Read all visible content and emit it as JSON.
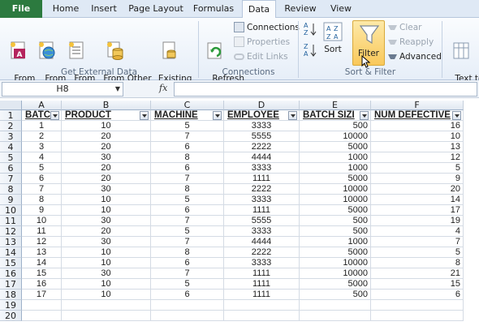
{
  "tabs": [
    "File",
    "Home",
    "Insert",
    "Page Layout",
    "Formulas",
    "Data",
    "Review",
    "View"
  ],
  "active_tab": "Data",
  "ribbon": {
    "from_access": "From\nAccess",
    "from_web": "From\nWeb",
    "from_text": "From\nText",
    "from_other": "From Other\nSources ▾",
    "existing": "Existing\nConnections",
    "group_external": "Get External Data",
    "refresh": "Refresh\nAll ▾",
    "connections": "Connections",
    "properties": "Properties",
    "edit_links": "Edit Links",
    "group_connections": "Connections",
    "sort": "Sort",
    "filter": "Filter",
    "clear": "Clear",
    "reapply": "Reapply",
    "advanced": "Advanced",
    "group_sort": "Sort & Filter",
    "text_to_columns": "Text to\nColumns"
  },
  "formula_bar": {
    "name_box": "H8",
    "fx": "fx",
    "formula": ""
  },
  "columns": [
    "A",
    "B",
    "C",
    "D",
    "E",
    "F"
  ],
  "headers": [
    "BATC",
    "PRODUCT",
    "MACHINE",
    "EMPLOYEE",
    "BATCH SIZI",
    "NUM DEFECTIVE"
  ],
  "row_numbers": [
    "1",
    "2",
    "3",
    "4",
    "5",
    "6",
    "7",
    "8",
    "9",
    "10",
    "11",
    "12",
    "13",
    "14",
    "15",
    "16",
    "17",
    "18",
    "19",
    "20"
  ],
  "rows": [
    [
      "1",
      "10",
      "5",
      "3333",
      "500",
      "16"
    ],
    [
      "2",
      "20",
      "7",
      "5555",
      "10000",
      "10"
    ],
    [
      "3",
      "20",
      "6",
      "2222",
      "5000",
      "13"
    ],
    [
      "4",
      "30",
      "8",
      "4444",
      "1000",
      "12"
    ],
    [
      "5",
      "20",
      "6",
      "3333",
      "1000",
      "5"
    ],
    [
      "6",
      "20",
      "7",
      "1111",
      "5000",
      "9"
    ],
    [
      "7",
      "30",
      "8",
      "2222",
      "10000",
      "20"
    ],
    [
      "8",
      "10",
      "5",
      "3333",
      "10000",
      "14"
    ],
    [
      "9",
      "10",
      "6",
      "1111",
      "5000",
      "17"
    ],
    [
      "10",
      "30",
      "7",
      "5555",
      "500",
      "19"
    ],
    [
      "11",
      "20",
      "5",
      "3333",
      "500",
      "4"
    ],
    [
      "12",
      "30",
      "7",
      "4444",
      "1000",
      "7"
    ],
    [
      "13",
      "10",
      "8",
      "2222",
      "5000",
      "5"
    ],
    [
      "14",
      "10",
      "6",
      "3333",
      "10000",
      "8"
    ],
    [
      "15",
      "30",
      "7",
      "1111",
      "10000",
      "21"
    ],
    [
      "16",
      "10",
      "5",
      "1111",
      "5000",
      "15"
    ],
    [
      "17",
      "10",
      "6",
      "1111",
      "500",
      "6"
    ]
  ]
}
